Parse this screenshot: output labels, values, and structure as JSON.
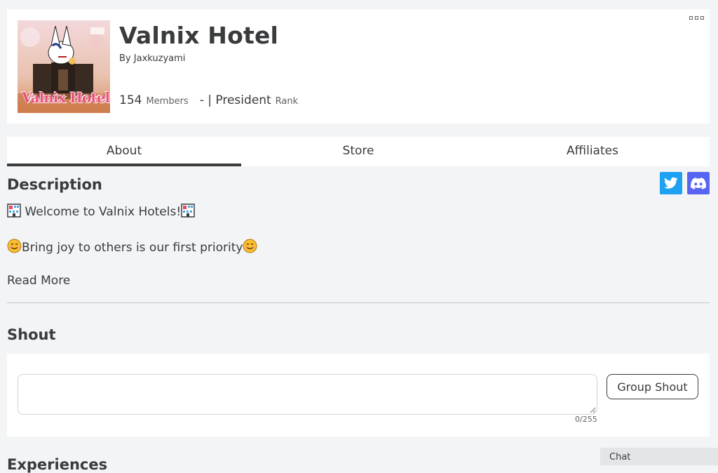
{
  "group": {
    "name": "Valnix Hotel",
    "owner_prefix": "By",
    "owner": "Jaxkuzyami",
    "member_count": "154",
    "members_label": "Members",
    "rank_value": "- | President",
    "rank_label": "Rank",
    "emblem_text": "Valnix Hotel"
  },
  "tabs": [
    {
      "label": "About",
      "active": true
    },
    {
      "label": "Store",
      "active": false
    },
    {
      "label": "Affiliates",
      "active": false
    }
  ],
  "description": {
    "title": "Description",
    "line1": "Welcome to Valnix Hotels!",
    "line2": "Bring joy to others is our first priority",
    "read_more": "Read More"
  },
  "social": {
    "twitter_icon": "twitter-icon",
    "discord_icon": "discord-icon",
    "twitter_color": "#1da1f2",
    "discord_color": "#5865f2"
  },
  "shout": {
    "title": "Shout",
    "input_value": "",
    "char_count": "0/255",
    "button_label": "Group Shout"
  },
  "experiences": {
    "title": "Experiences"
  },
  "chat": {
    "label": "Chat"
  }
}
